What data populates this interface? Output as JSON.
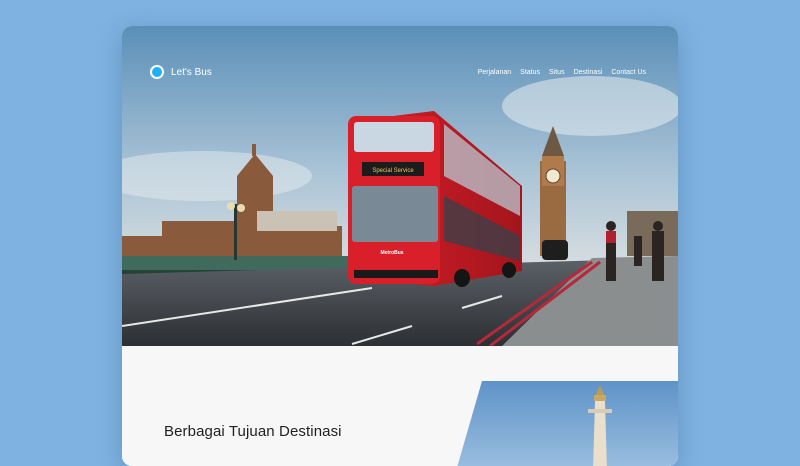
{
  "brand": {
    "name": "Let's Bus",
    "accent": "#1db0f2"
  },
  "nav": {
    "items": [
      "Perjalanan",
      "Status",
      "Situs",
      "Destinasi",
      "Contact Us"
    ]
  },
  "hero": {
    "bus_sign": "Special Service",
    "bus_brand": "MetroBus",
    "bus_color": "#d0202a"
  },
  "section": {
    "title": "Berbagai Tujuan Destinasi"
  }
}
